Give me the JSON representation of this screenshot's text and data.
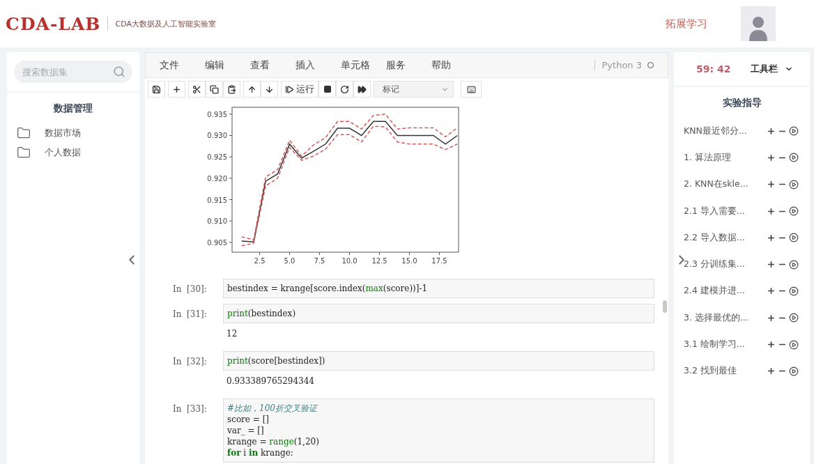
{
  "header": {
    "logo": "CDA-LAB",
    "subtitle": "CDA大数据及人工智能实验室",
    "link": "拓展学习"
  },
  "left_panel": {
    "search": {
      "placeholder": "搜索数据集"
    },
    "title": "数据管理",
    "items": [
      {
        "label": "数据市场"
      },
      {
        "label": "个人数据"
      }
    ]
  },
  "notebook": {
    "menu": [
      "文件",
      "编辑",
      "查看",
      "插入",
      "单元格",
      "服务",
      "帮助"
    ],
    "kernel": "Python 3",
    "toolbar": {
      "run_label": "运行",
      "cell_type": "标记"
    },
    "output_chart": {
      "chart_data": {
        "type": "line",
        "x": [
          1,
          2,
          3,
          4,
          5,
          6,
          7,
          8,
          9,
          10,
          11,
          12,
          13,
          14,
          15,
          16,
          17,
          18,
          19
        ],
        "xlim": [
          0.2,
          19.1
        ],
        "ylim": [
          0.9027,
          0.9366
        ],
        "xticks": [
          {
            "value": 2.5,
            "label": "2.5"
          },
          {
            "value": 5,
            "label": "5.0"
          },
          {
            "value": 7.5,
            "label": "7.5"
          },
          {
            "value": 10,
            "label": "10.0"
          },
          {
            "value": 12.5,
            "label": "12.5"
          },
          {
            "value": 15,
            "label": "15.0"
          },
          {
            "value": 17.5,
            "label": "17.5"
          }
        ],
        "yticks": [
          {
            "value": 0.905,
            "label": "0.905"
          },
          {
            "value": 0.91,
            "label": "0.910"
          },
          {
            "value": 0.915,
            "label": "0.915"
          },
          {
            "value": 0.92,
            "label": "0.920"
          },
          {
            "value": 0.925,
            "label": "0.925"
          },
          {
            "value": 0.93,
            "label": "0.930"
          },
          {
            "value": 0.935,
            "label": "0.935"
          }
        ],
        "series": [
          {
            "color": "#333333",
            "line_style": "solid",
            "values": [
              0.9053,
              0.9051,
              0.9193,
              0.921,
              0.928,
              0.9247,
              0.9263,
              0.928,
              0.9317,
              0.9317,
              0.93,
              0.9333,
              0.9333,
              0.93,
              0.93,
              0.93,
              0.93,
              0.928,
              0.93
            ]
          },
          {
            "color": "#d05a5a",
            "line_style": "dashed",
            "values": [
              0.9063,
              0.9056,
              0.9203,
              0.922,
              0.9289,
              0.9252,
              0.9278,
              0.9295,
              0.9333,
              0.9333,
              0.9315,
              0.9347,
              0.935,
              0.9315,
              0.9318,
              0.9318,
              0.9318,
              0.9297,
              0.9318
            ]
          },
          {
            "color": "#d05a5a",
            "line_style": "dashed",
            "values": [
              0.9042,
              0.9048,
              0.9182,
              0.92,
              0.9272,
              0.9242,
              0.9252,
              0.9268,
              0.9302,
              0.9302,
              0.9285,
              0.9322,
              0.932,
              0.9285,
              0.928,
              0.928,
              0.928,
              0.9267,
              0.928
            ]
          }
        ]
      }
    },
    "cells": [
      {
        "prompt": "In  [30]:",
        "code": [
          [
            {
              "t": "bestindex = krange[score.index(",
              "kind": "plain"
            },
            {
              "t": "max",
              "kind": "builtin"
            },
            {
              "t": "(score))]-1",
              "kind": "plain"
            }
          ]
        ]
      },
      {
        "prompt": "In  [31]:",
        "code": [
          [
            {
              "t": "print",
              "kind": "builtin"
            },
            {
              "t": "(bestindex)",
              "kind": "plain"
            }
          ]
        ],
        "output": "12"
      },
      {
        "prompt": "In  [32]:",
        "code": [
          [
            {
              "t": "print",
              "kind": "builtin"
            },
            {
              "t": "(score[bestindex])",
              "kind": "plain"
            }
          ]
        ],
        "output": "0.933389765294344"
      },
      {
        "prompt": "In  [33]:",
        "code": [
          [
            {
              "t": "#比如，100折交叉验证",
              "kind": "comment"
            }
          ],
          [
            {
              "t": "score = []",
              "kind": "plain"
            }
          ],
          [
            {
              "t": "var_ = []",
              "kind": "plain"
            }
          ],
          [
            {
              "t": "krange = ",
              "kind": "plain"
            },
            {
              "t": "range",
              "kind": "builtin"
            },
            {
              "t": "(1,20)",
              "kind": "plain"
            }
          ],
          [
            {
              "t": "for",
              "kind": "keyword"
            },
            {
              "t": " i ",
              "kind": "plain"
            },
            {
              "t": "in",
              "kind": "keyword"
            },
            {
              "t": " krange:",
              "kind": "plain"
            }
          ]
        ]
      }
    ]
  },
  "right_panel": {
    "timer": "59: 42",
    "toolbar_menu": "工具栏",
    "title": "实验指导",
    "items": [
      "KNN最近邻分...",
      "1. 算法原理",
      "2. KNN在skle...",
      "2.1 导入需要...",
      "2.2 导入数据...",
      "2.3 分训练集...",
      "2.4 建模并进...",
      "3. 选择最优的...",
      "3.1 绘制学习...",
      "3.2 找到最佳"
    ]
  }
}
